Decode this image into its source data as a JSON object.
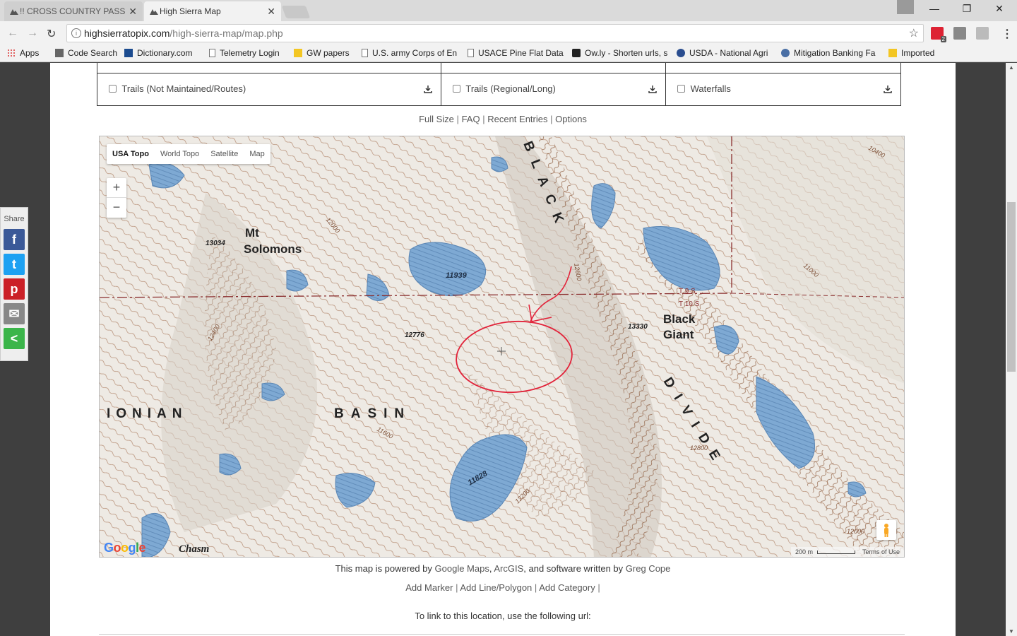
{
  "browser": {
    "tabs": [
      {
        "label": "!! CROSS COUNTRY PASS",
        "active": false
      },
      {
        "label": "High Sierra Map",
        "active": true
      }
    ],
    "url_host": "highsierratopix.com",
    "url_path": "/high-sierra-map/map.php",
    "extension_badge": "2",
    "bookmarks": [
      {
        "label": "Apps",
        "icon": "apps-grid-icon"
      },
      {
        "label": "Code Search",
        "icon": "code-search-icon"
      },
      {
        "label": "Dictionary.com",
        "icon": "dictionary-icon"
      },
      {
        "label": "Telemetry Login",
        "icon": "page-icon"
      },
      {
        "label": "GW papers",
        "icon": "folder-icon"
      },
      {
        "label": "U.S. army Corps of En",
        "icon": "page-icon"
      },
      {
        "label": "USACE Pine Flat Data",
        "icon": "page-icon"
      },
      {
        "label": "Ow.ly - Shorten urls, s",
        "icon": "owly-icon"
      },
      {
        "label": "USDA - National Agri",
        "icon": "usda-icon"
      },
      {
        "label": "Mitigation Banking Fa",
        "icon": "mitigation-icon"
      },
      {
        "label": "Imported",
        "icon": "folder-icon"
      }
    ]
  },
  "layers": [
    {
      "label": "Trails (Not Maintained/Routes)",
      "checked": false
    },
    {
      "label": "Trails (Regional/Long)",
      "checked": false
    },
    {
      "label": "Waterfalls",
      "checked": false
    }
  ],
  "links_row": {
    "full_size": "Full Size",
    "faq": "FAQ",
    "recent": "Recent Entries",
    "options": "Options",
    "sep": "|"
  },
  "map": {
    "types": [
      "USA Topo",
      "World Topo",
      "Satellite",
      "Map"
    ],
    "selected_type": "USA Topo",
    "zoom_in": "+",
    "zoom_out": "−",
    "google_logo": "Google",
    "scale": "200 m",
    "terms": "Terms of Use",
    "labels": {
      "mt_solomons_1": "Mt",
      "mt_solomons_2": "Solomons",
      "solomons_elev": "13034",
      "lake1": "11939",
      "peak_12776": "12776",
      "black_giant_1": "Black",
      "black_giant_2": "Giant",
      "black_giant_elev": "13330",
      "ionian": "IONIAN",
      "basin": "BASIN",
      "lake2": "11828",
      "chasm": "Chasm",
      "black_divide_top": "BLACK",
      "black_divide_bottom": "DIVIDE",
      "c12600": "12600",
      "c12000a": "12000",
      "c12400": "12400",
      "c11600": "11600",
      "c12200": "12200",
      "c12800": "12800",
      "c11000": "11000",
      "c10400": "10400",
      "c12000b": "12000",
      "tcode1": "T 9 S",
      "tcode2": "T 10 S"
    }
  },
  "footer": {
    "powered_prefix": "This map is powered by",
    "google_maps": "Google Maps",
    "arcgis": "ArcGIS",
    "powered_mid": ", and software written by",
    "author": "Greg Cope",
    "add_marker": "Add Marker",
    "add_line": "Add Line/Polygon",
    "add_category": "Add Category",
    "sep": "|",
    "link_text": "To link to this location, use the following url:"
  },
  "share": {
    "label": "Share",
    "buttons": [
      {
        "name": "facebook",
        "glyph": "f",
        "color": "#3b5998"
      },
      {
        "name": "twitter",
        "glyph": "t",
        "color": "#1da1f2"
      },
      {
        "name": "pinterest",
        "glyph": "p",
        "color": "#cb2027"
      },
      {
        "name": "email",
        "glyph": "✉",
        "color": "#888888"
      },
      {
        "name": "sharethis",
        "glyph": "<",
        "color": "#3bb54a"
      }
    ]
  }
}
